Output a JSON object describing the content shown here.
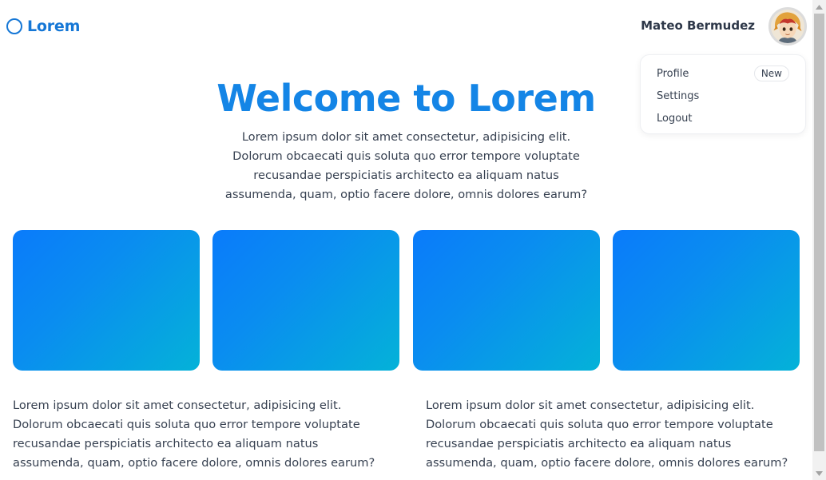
{
  "header": {
    "brand": "Lorem",
    "user_name": "Mateo Bermudez",
    "avatar_icon": "avatar-icon"
  },
  "dropdown": {
    "items": [
      {
        "label": "Profile",
        "badge": "New"
      },
      {
        "label": "Settings"
      },
      {
        "label": "Logout"
      }
    ]
  },
  "hero": {
    "title": "Welcome to Lorem",
    "text": "Lorem ipsum dolor sit amet consectetur, adipisicing elit. Dolorum obcaecati quis soluta quo error tempore voluptate recusandae perspiciatis architecto ea aliquam natus assumenda, quam, optio facere dolore, omnis dolores earum?"
  },
  "cards": {
    "count": 4
  },
  "columns": [
    {
      "text": "Lorem ipsum dolor sit amet consectetur, adipisicing elit. Dolorum obcaecati quis soluta quo error tempore voluptate recusandae perspiciatis architecto ea aliquam natus assumenda, quam, optio facere dolore, omnis dolores earum?"
    },
    {
      "text": "Lorem ipsum dolor sit amet consectetur, adipisicing elit. Dolorum obcaecati quis soluta quo error tempore voluptate recusandae perspiciatis architecto ea aliquam natus assumenda, quam, optio facere dolore, omnis dolores earum?"
    }
  ],
  "colors": {
    "brand": "#1577d6",
    "title": "#1485e6",
    "card_gradient_start": "#0a7bfb",
    "card_gradient_end": "#04b2d8",
    "text": "#374151"
  }
}
